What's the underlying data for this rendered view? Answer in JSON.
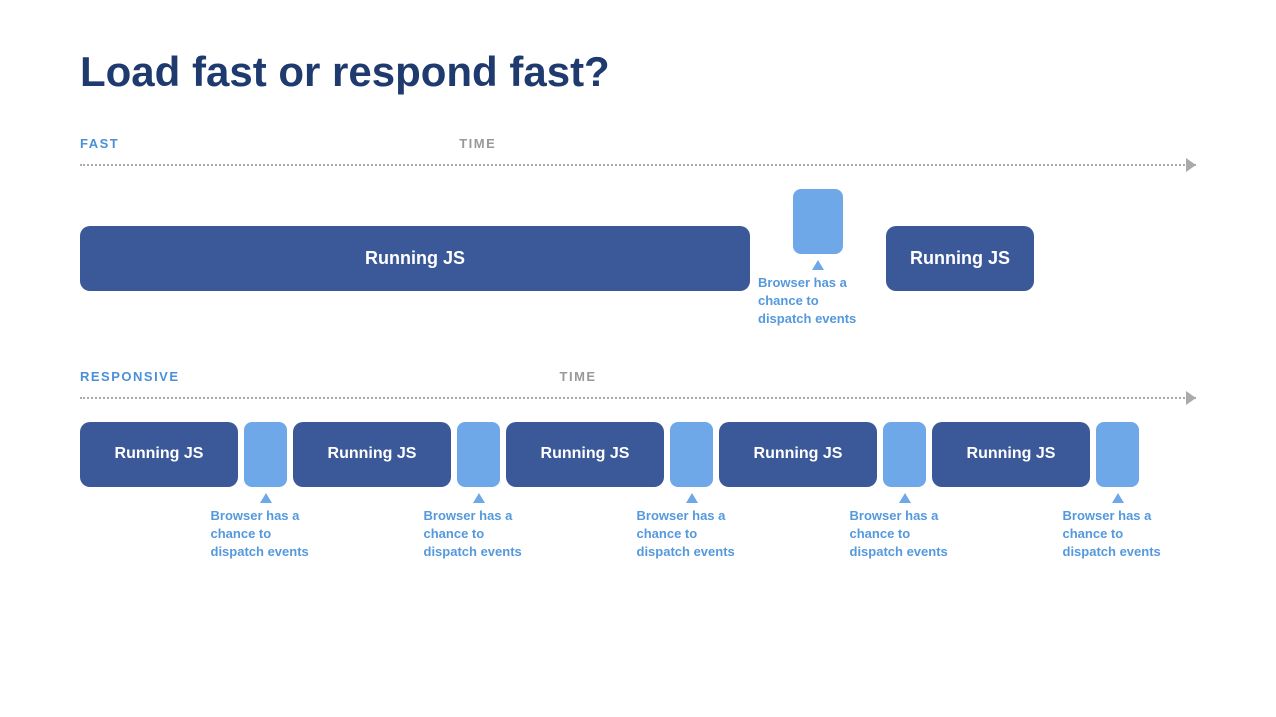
{
  "title": "Load fast or respond fast?",
  "fast_section": {
    "label": "FAST",
    "time_label": "TIME",
    "running_js_label": "Running JS",
    "annotation_text": "Browser has a\nchance to\ndispatch events"
  },
  "responsive_section": {
    "label": "RESPONSIVE",
    "time_label": "TIME",
    "running_js_label": "Running JS",
    "annotations": [
      "Browser has a\nchance to\ndispatch events",
      "Browser has a\nchance to\ndispatch events",
      "Browser has a\nchance to\ndispatch events",
      "Browser has a\nchance to\ndispatch events",
      "Browser has a\nchance to\ndispatch events"
    ]
  }
}
